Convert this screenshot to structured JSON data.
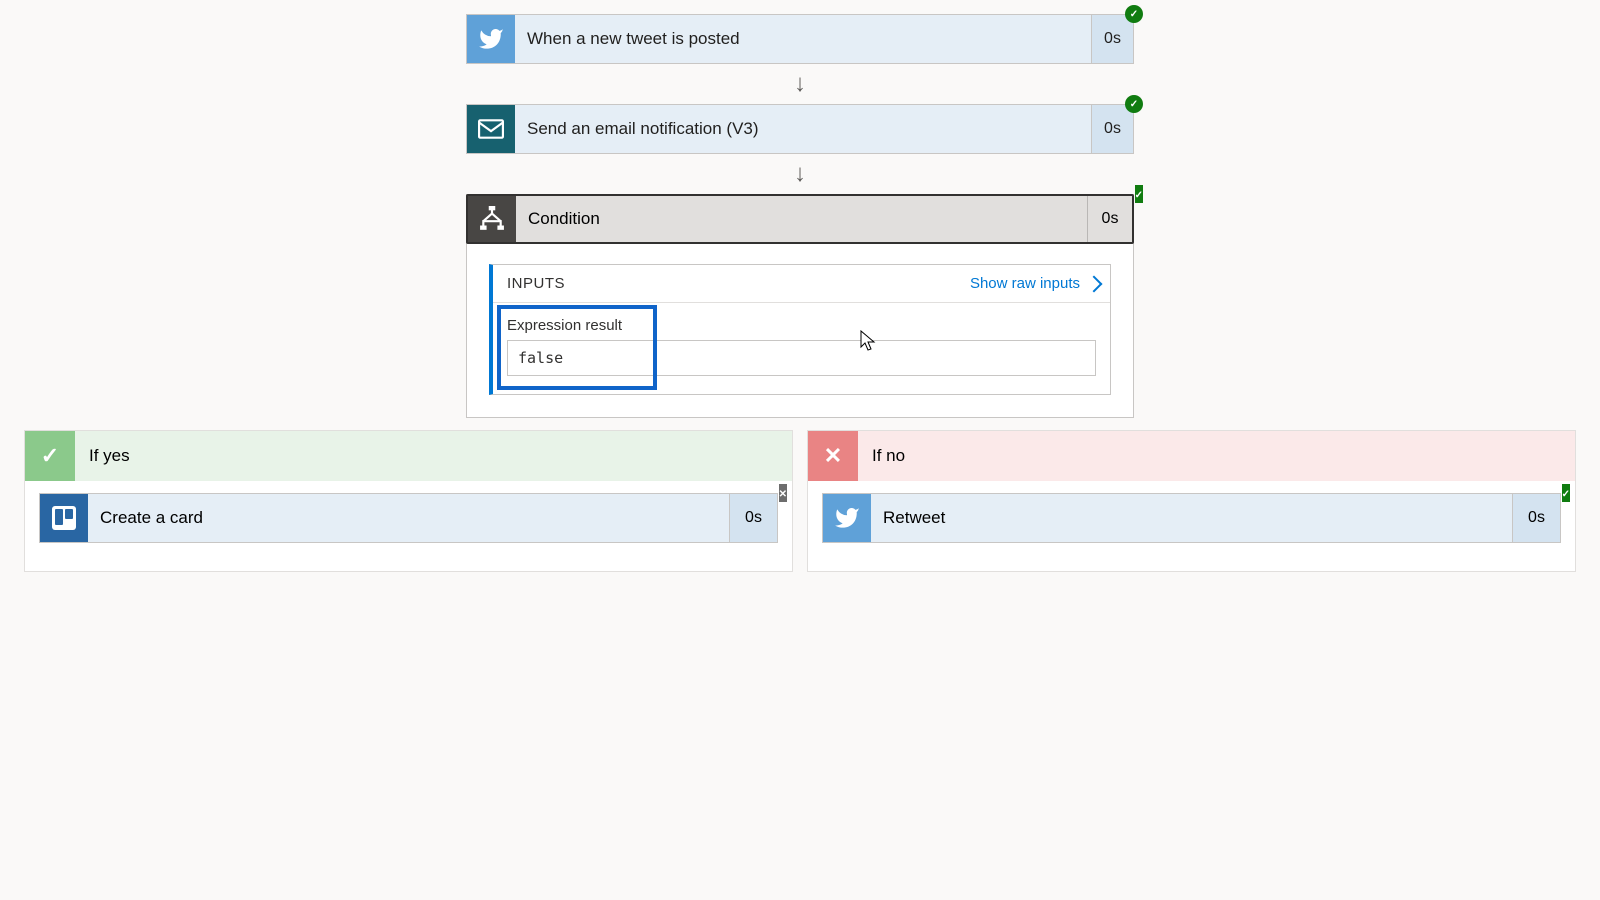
{
  "steps": {
    "trigger": {
      "label": "When a new tweet is posted",
      "duration": "0s"
    },
    "email": {
      "label": "Send an email notification (V3)",
      "duration": "0s"
    },
    "condition": {
      "label": "Condition",
      "duration": "0s"
    }
  },
  "condition_detail": {
    "inputs_label": "INPUTS",
    "show_raw": "Show raw inputs",
    "expr_label": "Expression result",
    "expr_value": "false"
  },
  "branches": {
    "yes": {
      "label": "If yes",
      "action": {
        "label": "Create a card",
        "duration": "0s"
      }
    },
    "no": {
      "label": "If no",
      "action": {
        "label": "Retweet",
        "duration": "0s"
      }
    }
  }
}
